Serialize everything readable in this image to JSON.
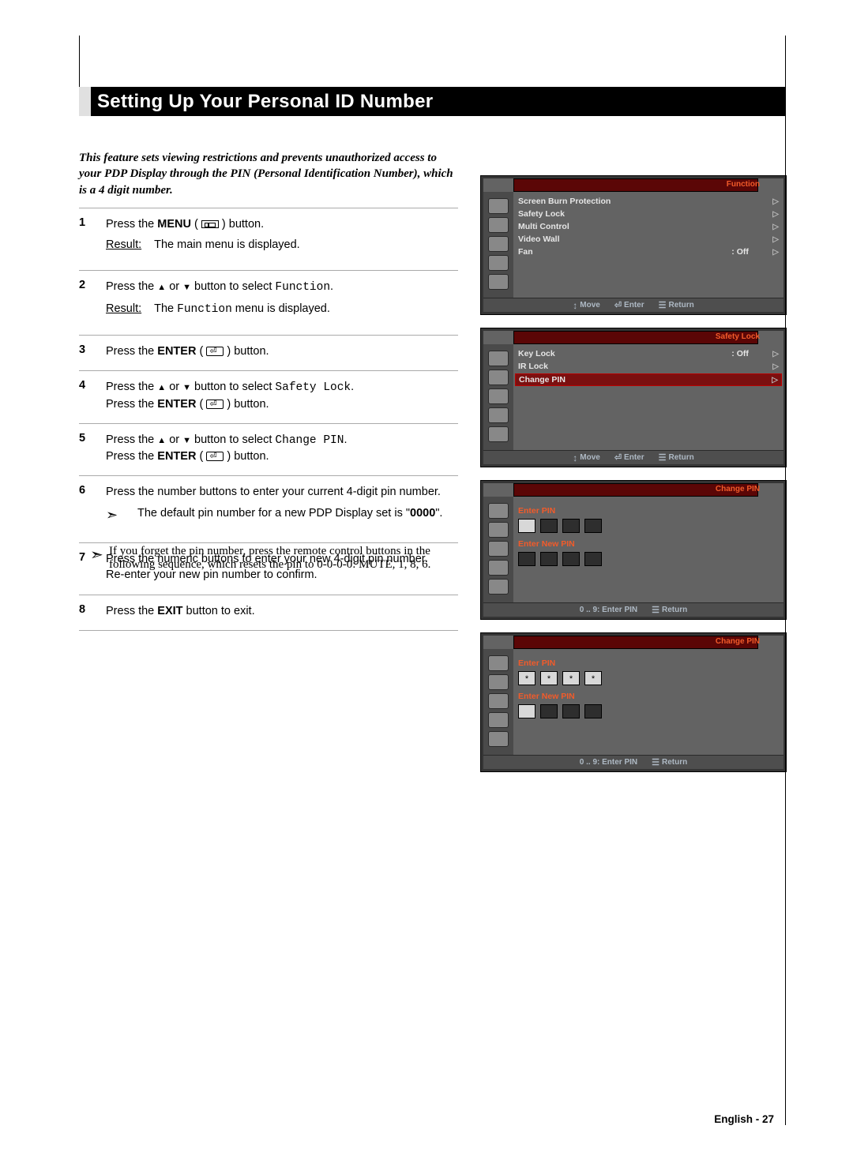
{
  "title": "Setting Up Your Personal ID Number",
  "intro": "This feature sets viewing restrictions and prevents unauthorized access to your PDP Display through the PIN (Personal Identification Number), which is a 4 digit number.",
  "steps": {
    "s1": {
      "n": "1",
      "a": "Press the ",
      "btn": "MENU",
      "b": " ( ",
      "c": " ) button."
    },
    "r1": {
      "lbl": "Result:",
      "txt": "The main menu is displayed."
    },
    "s2": {
      "n": "2",
      "a": "Press the ",
      "b": " or ",
      "c": " button to select ",
      "mono": "Function",
      "d": "."
    },
    "r2": {
      "lbl": "Result:",
      "a": "The ",
      "mono": "Function",
      "b": " menu is displayed."
    },
    "s3": {
      "n": "3",
      "a": "Press the ",
      "btn": "ENTER",
      "b": " ( ",
      "c": " ) button."
    },
    "s4": {
      "n": "4",
      "a": "Press the ",
      "b": " or ",
      "c": " button to select ",
      "mono": "Safety Lock",
      "d": ".",
      "line2a": "Press the ",
      "line2btn": "ENTER",
      "line2b": " ( ",
      "line2c": " ) button."
    },
    "s5": {
      "n": "5",
      "a": "Press the ",
      "b": " or ",
      "c": " button to select ",
      "mono": "Change PIN",
      "d": ".",
      "line2a": "Press the ",
      "line2btn": "ENTER",
      "line2b": " ( ",
      "line2c": " ) button."
    },
    "s6": {
      "n": "6",
      "txt": "Press the number buttons to enter your current 4-digit pin number."
    },
    "note6": {
      "a": "The default pin number for a new PDP Display set is \"",
      "bold": "0000",
      "b": "\"."
    },
    "s7": {
      "n": "7",
      "l1": "Press the numeric buttons to enter your new 4-digit pin number.",
      "l2": "Re-enter your new pin number to confirm."
    },
    "s8": {
      "n": "8",
      "a": "Press the ",
      "btn": "EXIT",
      "b": " button to exit."
    }
  },
  "footnote": "If you forget the pin number, press the remote control buttons in the following sequence, which resets the pin to 0-0-0-0: MUTE, 1, 8, 6.",
  "osd": {
    "function": {
      "title": "Function",
      "rows": [
        {
          "name": "Screen Burn Protection",
          "val": "",
          "tri": "▷"
        },
        {
          "name": "Safety Lock",
          "val": "",
          "tri": "▷"
        },
        {
          "name": "Multi Control",
          "val": "",
          "tri": "▷"
        },
        {
          "name": "Video Wall",
          "val": "",
          "tri": "▷"
        },
        {
          "name": "Fan",
          "val": ": Off",
          "tri": "▷"
        }
      ],
      "foot": {
        "move": "Move",
        "enter": "Enter",
        "ret": "Return"
      }
    },
    "safety": {
      "title": "Safety Lock",
      "rows": [
        {
          "name": "Key Lock",
          "val": ": Off",
          "tri": "▷",
          "hl": false
        },
        {
          "name": "IR Lock",
          "val": "",
          "tri": "▷",
          "hl": false
        },
        {
          "name": "Change PIN",
          "val": "",
          "tri": "▷",
          "hl": true
        }
      ],
      "foot": {
        "move": "Move",
        "enter": "Enter",
        "ret": "Return"
      }
    },
    "change1": {
      "title": "Change PIN",
      "enterLabel": "Enter PIN",
      "newLabel": "Enter New PIN",
      "foot": {
        "hint": "0 .. 9: Enter PIN",
        "ret": "Return"
      }
    },
    "change2": {
      "title": "Change PIN",
      "enterLabel": "Enter PIN",
      "newLabel": "Enter New PIN",
      "enterVals": [
        "*",
        "*",
        "*",
        "*"
      ],
      "foot": {
        "hint": "0 .. 9: Enter PIN",
        "ret": "Return"
      }
    }
  },
  "footer": "English - 27"
}
